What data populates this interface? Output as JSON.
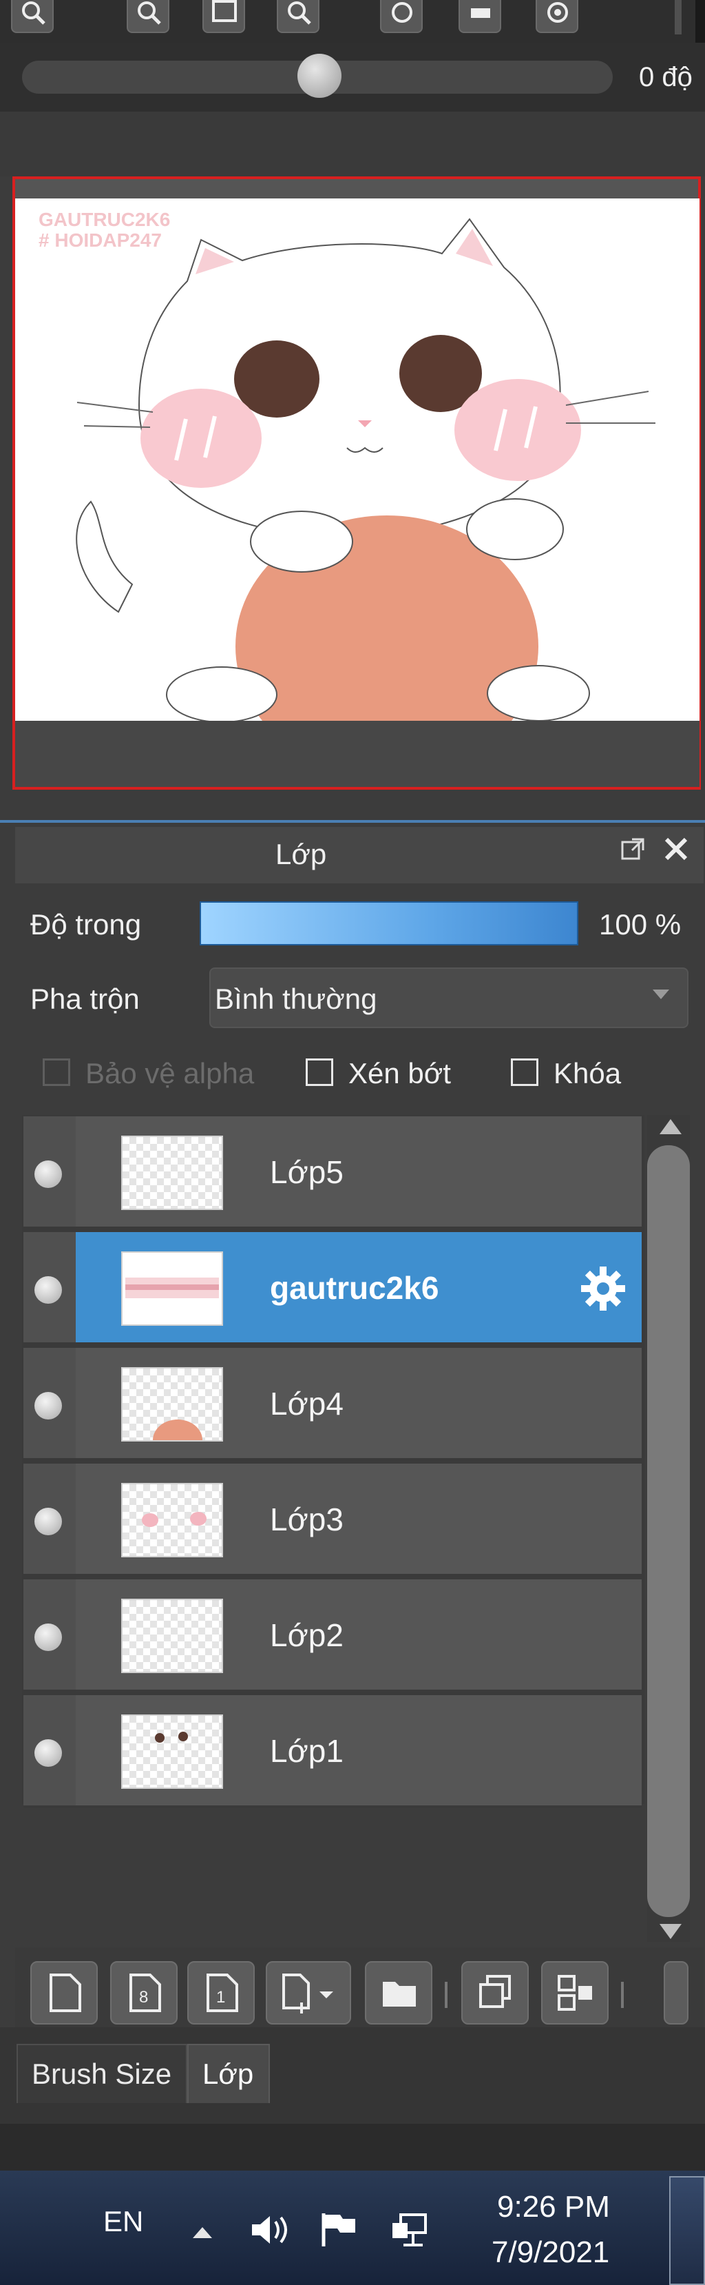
{
  "toolbar": {
    "icons": [
      "zoom-in-icon",
      "zoom-out-icon",
      "fit-icon",
      "zoom-100-icon",
      "rotate-left-icon",
      "flip-icon",
      "rotate-right-icon"
    ]
  },
  "rotation": {
    "value_label": "0 độ"
  },
  "navigator": {
    "watermark": "GAUTRUC2K6\n# HOIDAP247"
  },
  "layer_panel": {
    "title": "Lớp",
    "opacity_label": "Độ trong",
    "opacity_value": "100 %",
    "opacity_fraction": 1.0,
    "blend_label": "Pha trộn",
    "blend_value": "Bình thường",
    "protect_alpha_label": "Bảo vệ alpha",
    "clipping_label": "Xén bớt",
    "lock_label": "Khóa",
    "layers": [
      {
        "name": "Lớp5",
        "selected": false
      },
      {
        "name": "gautruc2k6",
        "selected": true
      },
      {
        "name": "Lớp4",
        "selected": false
      },
      {
        "name": "Lớp3",
        "selected": false
      },
      {
        "name": "Lớp2",
        "selected": false
      },
      {
        "name": "Lớp1",
        "selected": false
      }
    ]
  },
  "tabs": {
    "brush_size": "Brush Size",
    "layer": "Lớp"
  },
  "taskbar": {
    "language": "EN",
    "time": "9:26 PM",
    "date": "7/9/2021"
  },
  "colors": {
    "accent_blue": "#3f8fcf",
    "navigator_border": "#d72020",
    "cat_ball": "#e89a7f",
    "cat_cheek": "#f9c9d0",
    "cat_eye": "#5a3a30"
  }
}
